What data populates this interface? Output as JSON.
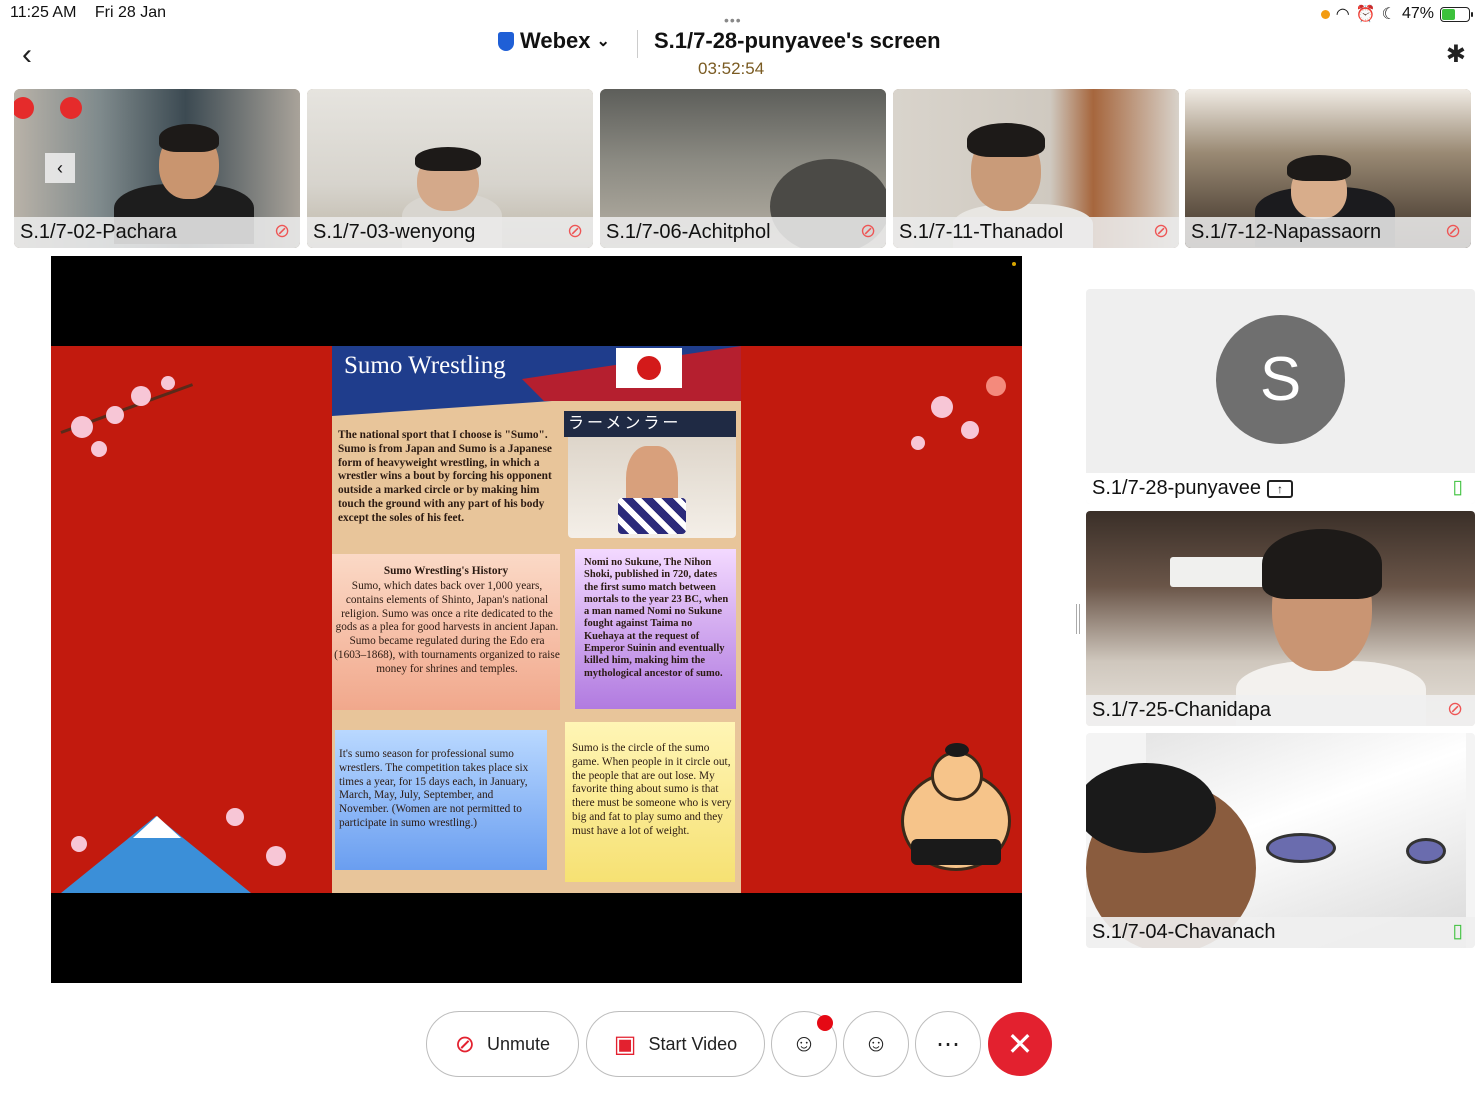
{
  "status": {
    "time": "11:25 AM",
    "date": "Fri 28 Jan",
    "battery": "47%",
    "battery_level": 0.47
  },
  "header": {
    "app_name": "Webex",
    "screen_title": "S.1/7-28-punyavee's screen",
    "timer": "03:52:54"
  },
  "thumbnails": [
    {
      "name": "S.1/7-02-Pachara"
    },
    {
      "name": "S.1/7-03-wenyong"
    },
    {
      "name": "S.1/7-06-Achitphol"
    },
    {
      "name": "S.1/7-11-Thanadol"
    },
    {
      "name": "S.1/7-12-Napassaorn"
    }
  ],
  "slide": {
    "title": "Sumo Wrestling",
    "banner": "ラーメンラー",
    "intro": "The national sport that I choose is \"Sumo\". Sumo is from Japan and Sumo is a Japanese form of heavyweight wrestling, in which a wrestler wins a bout by forcing his opponent outside a marked circle or by making him touch the ground with any part of his body except the soles of his feet.",
    "history_title": "Sumo Wrestling's History",
    "history": "Sumo, which dates back over 1,000 years, contains elements of Shinto, Japan's national religion. Sumo was once a rite dedicated to the gods as a plea for good harvests in ancient Japan. Sumo became regulated during the Edo era (1603–1868), with tournaments organized to raise money for shrines and temples.",
    "nomi": "Nomi no Sukune, The Nihon Shoki, published in 720, dates the first sumo match between mortals to the year 23 BC, when a man named Nomi no Sukune fought against Taima no Kuehaya at the request of Emperor Suinin and eventually killed him, making him the mythological ancestor of sumo.",
    "season": "It's sumo season for professional sumo wrestlers. The competition takes place six times a year, for 15 days each, in January, March, May, July, September, and November. (Women are not permitted to participate in sumo wrestling.)",
    "circle": "Sumo is the circle of the sumo game. When people in it circle out, the people that are out lose. My favorite thing about sumo is that there must be someone who is very big and fat to play sumo and they must have a lot of weight."
  },
  "side_tiles": [
    {
      "name": "S.1/7-28-punyavee",
      "initial": "S"
    },
    {
      "name": "S.1/7-25-Chanidapa"
    },
    {
      "name": "S.1/7-04-Chavanach"
    }
  ],
  "controls": {
    "unmute_label": "Unmute",
    "start_video_label": "Start Video"
  },
  "colors": {
    "end_call": "#e3212f",
    "slide_background": "#c21a0e",
    "muted_mic": "#e55555",
    "active_mic": "#3cc13b"
  }
}
